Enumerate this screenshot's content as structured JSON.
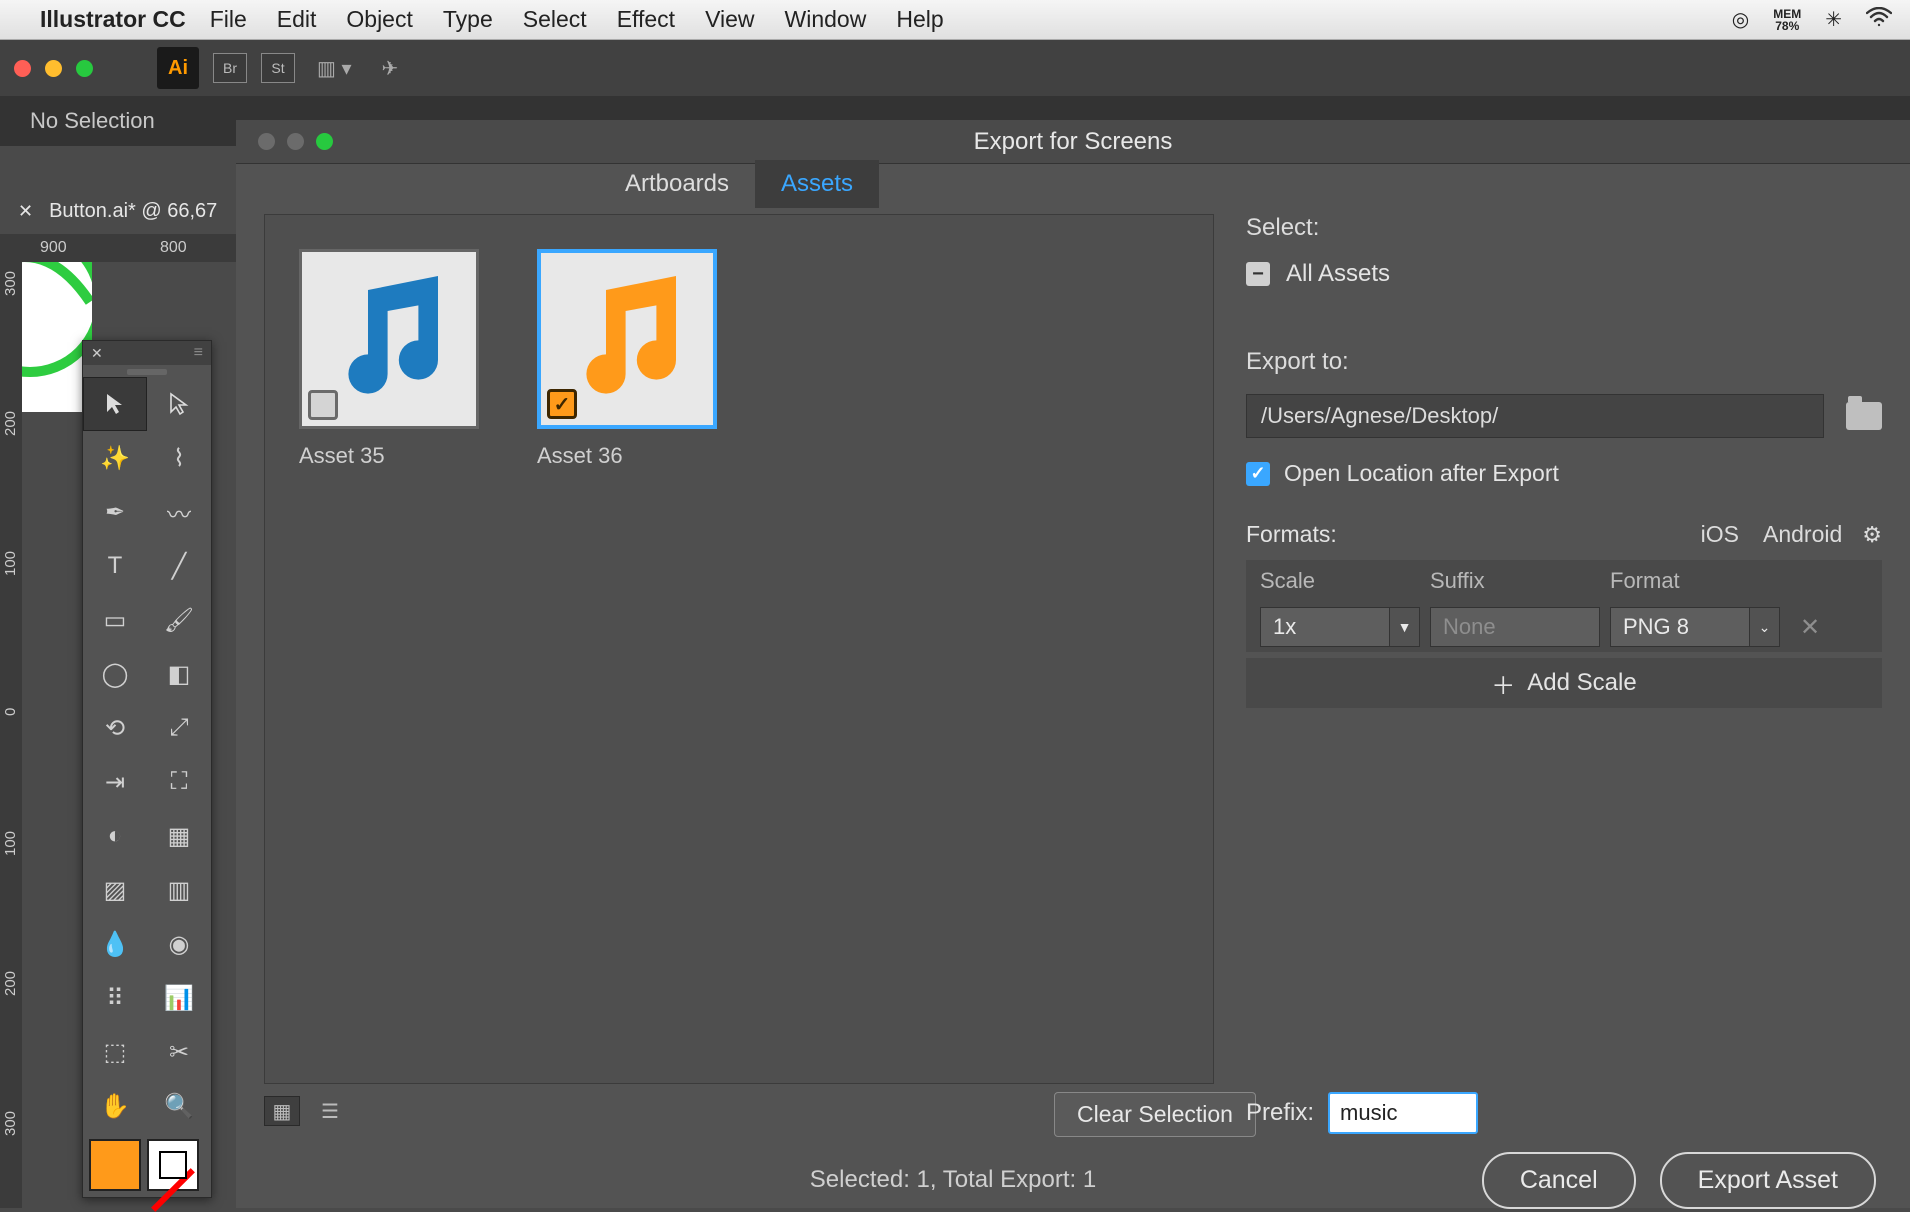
{
  "menubar": {
    "appname": "Illustrator CC",
    "items": [
      "File",
      "Edit",
      "Object",
      "Type",
      "Select",
      "Effect",
      "View",
      "Window",
      "Help"
    ],
    "mem_label": "MEM",
    "mem_value": "78%"
  },
  "appbar": {
    "br": "Br",
    "st": "St"
  },
  "selbar": {
    "text": "No Selection"
  },
  "doctab": {
    "label": "Button.ai* @ 66,67"
  },
  "ruler": {
    "t900": "900",
    "t800": "800",
    "v_labels": [
      "300",
      "200",
      "100",
      "0",
      "100",
      "200",
      "300"
    ]
  },
  "dialog": {
    "title": "Export for Screens",
    "tabs": {
      "artboards": "Artboards",
      "assets": "Assets"
    },
    "assets": [
      {
        "name": "Asset 35",
        "color": "#1e7bbf",
        "selected": false
      },
      {
        "name": "Asset 36",
        "color": "#ff9a1a",
        "selected": true
      }
    ],
    "clear": "Clear Selection",
    "select_label": "Select:",
    "all_assets": "All Assets",
    "export_to": "Export to:",
    "export_path": "/Users/Agnese/Desktop/",
    "open_location": "Open Location after Export",
    "formats_label": "Formats:",
    "plat_ios": "iOS",
    "plat_android": "Android",
    "col_scale": "Scale",
    "col_suffix": "Suffix",
    "col_format": "Format",
    "scale_val": "1x",
    "suffix_val": "None",
    "format_val": "PNG 8",
    "add_scale": "Add Scale",
    "prefix_label": "Prefix:",
    "prefix_value": "music",
    "status": "Selected: 1, Total Export: 1",
    "cancel": "Cancel",
    "export": "Export Asset"
  }
}
